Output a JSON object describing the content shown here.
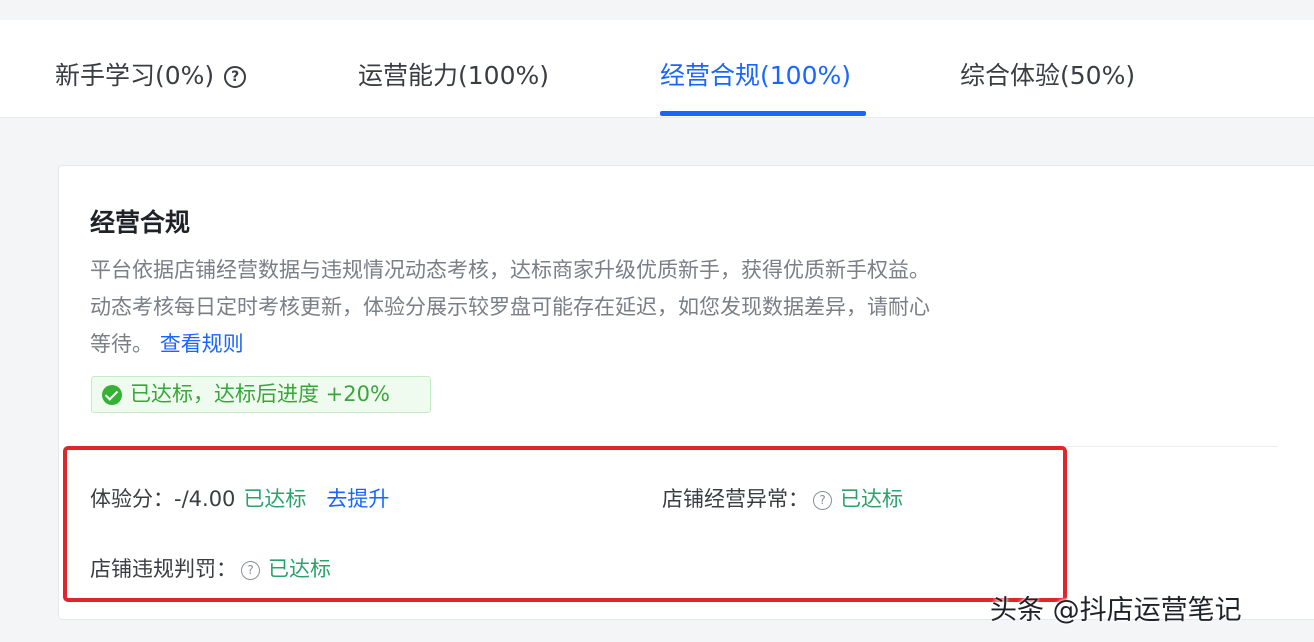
{
  "tabs": [
    {
      "label": "新手学习(0%)",
      "has_help": true,
      "active": false
    },
    {
      "label": "运营能力(100%)",
      "active": false
    },
    {
      "label": "经营合规(100%)",
      "active": true
    },
    {
      "label": "综合体验(50%)",
      "active": false
    }
  ],
  "help_icon_glyph": "?",
  "card": {
    "title": "经营合规",
    "description": "平台依据店铺经营数据与违规情况动态考核，达标商家升级优质新手，获得优质新手权益。动态考核每日定时考核更新，体验分展示较罗盘可能存在延迟，如您发现数据差异，请耐心等待。",
    "rule_link": "查看规则",
    "badge": "已达标，达标后进度 +20%"
  },
  "metrics": {
    "experience_label": "体验分：-/4.00",
    "experience_status": "已达标",
    "experience_action": "去提升",
    "store_abnormal_label": "店铺经营异常：",
    "store_abnormal_status": "已达标",
    "violation_label": "店铺违规判罚：",
    "violation_status": "已达标"
  },
  "watermark": "头条 @抖店运营笔记",
  "colors": {
    "accent": "#1966ff",
    "success": "#2aa36b",
    "highlight_box": "#e0262b"
  }
}
